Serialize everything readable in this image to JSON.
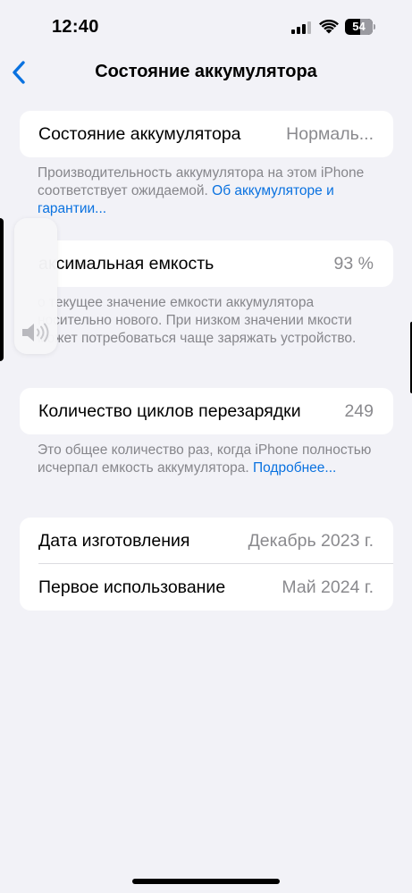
{
  "status_bar": {
    "time": "12:40",
    "battery_level": "54",
    "battery_fraction": 0.54
  },
  "nav": {
    "title": "Состояние аккумулятора",
    "back_icon": "chevron-left-icon"
  },
  "battery_health": {
    "label": "Состояние аккумулятора",
    "value": "Нормаль...",
    "footnote_text": "Производительность аккумулятора на этом iPhone соответствует ожидаемой. ",
    "footnote_link": "Об аккумуляторе и гарантии..."
  },
  "max_capacity": {
    "label": "аксимальная емкость",
    "value": "93 %",
    "footnote": "о текущее значение емкости аккумулятора носительно нового. При низком значении мкости может потребоваться чаще заряжать устройство."
  },
  "cycle_count": {
    "label": "Количество циклов перезарядки",
    "value": "249",
    "footnote_text": "Это общее количество раз, когда iPhone полностью исчерпал емкость аккумулятора. ",
    "footnote_link": "Подробнее..."
  },
  "dates": {
    "manufacture_label": "Дата изготовления",
    "manufacture_value": "Декабрь 2023 г.",
    "first_use_label": "Первое использование",
    "first_use_value": "Май 2024 г."
  },
  "volume_hud": {
    "icon": "speaker-icon",
    "level_fraction": 0.0
  },
  "colors": {
    "background": "#f2f2f7",
    "accent": "#0a72e0",
    "secondary_text": "#8a8a8e"
  }
}
